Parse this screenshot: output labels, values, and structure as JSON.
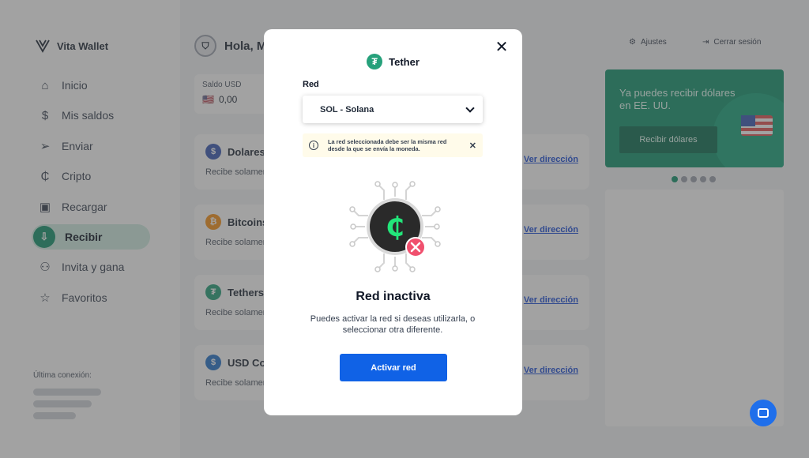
{
  "app": {
    "brand": "Vita Wallet"
  },
  "sidebar": {
    "items": [
      {
        "label": "Inicio",
        "icon": "home-icon"
      },
      {
        "label": "Mis saldos",
        "icon": "dollar-icon"
      },
      {
        "label": "Enviar",
        "icon": "send-icon"
      },
      {
        "label": "Cripto",
        "icon": "crypto-icon"
      },
      {
        "label": "Recargar",
        "icon": "wallet-icon"
      },
      {
        "label": "Recibir",
        "icon": "receive-icon",
        "active": true
      },
      {
        "label": "Invita y gana",
        "icon": "users-icon"
      },
      {
        "label": "Favoritos",
        "icon": "star-icon"
      }
    ],
    "last_connection_label": "Última conexión:"
  },
  "header": {
    "greeting": "Hola, M",
    "settings_label": "Ajustes",
    "logout_label": "Cerrar sesión"
  },
  "balance": {
    "label": "Saldo USD",
    "value": "0,00"
  },
  "cards": [
    {
      "title": "Dolares",
      "subtitle": "Recibe solamen",
      "link": "Ver dirección"
    },
    {
      "title": "Bitcoins",
      "subtitle": "Recibe solamen",
      "link": "Ver dirección"
    },
    {
      "title": "Tethers",
      "subtitle": "Recibe solamen",
      "link": "Ver dirección"
    },
    {
      "title": "USD Coi",
      "subtitle": "Recibe solamen",
      "link": "Ver dirección"
    }
  ],
  "promo": {
    "text": "Ya puedes recibir dólares en EE. UU.",
    "button": "Recibir dólares",
    "dots_count": 5,
    "active_dot": 0
  },
  "modal": {
    "coin_name": "Tether",
    "network_label": "Red",
    "network_selected": "SOL - Solana",
    "alert_text": "La red seleccionada debe ser la misma red desde la que se envía la moneda.",
    "title": "Red inactiva",
    "description": "Puedes activar la red si deseas utilizarla, o seleccionar otra diferente.",
    "activate_button": "Activar red"
  },
  "colors": {
    "brand_green": "#14946e",
    "primary_blue": "#1062e6",
    "tether_green": "#26a17b",
    "error_pink": "#f0506e"
  }
}
